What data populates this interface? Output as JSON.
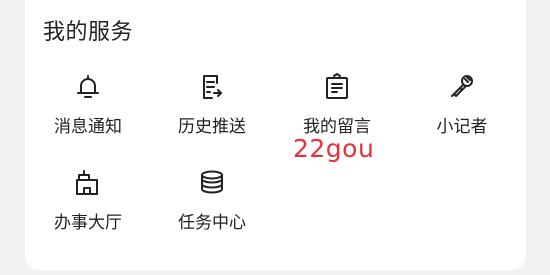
{
  "section": {
    "title": "我的服务"
  },
  "services": [
    {
      "label": "消息通知",
      "icon": "bell-icon"
    },
    {
      "label": "历史推送",
      "icon": "history-push-icon"
    },
    {
      "label": "我的留言",
      "icon": "message-board-icon"
    },
    {
      "label": "小记者",
      "icon": "microphone-icon"
    },
    {
      "label": "办事大厅",
      "icon": "service-hall-icon"
    },
    {
      "label": "任务中心",
      "icon": "task-database-icon"
    }
  ],
  "watermark": {
    "text": "22gou"
  },
  "colors": {
    "background": "#f2f2f4",
    "card": "#ffffff",
    "text": "#222222",
    "watermark": "#e8303a"
  }
}
